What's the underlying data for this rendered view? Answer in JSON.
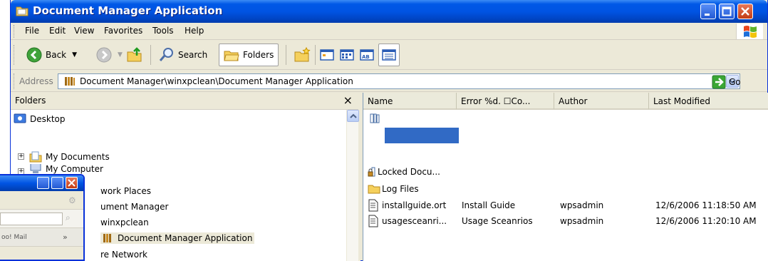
{
  "window": {
    "title": "Document Manager Application",
    "icon": "folder-icon"
  },
  "menu": [
    "File",
    "Edit",
    "View",
    "Favorites",
    "Tools",
    "Help"
  ],
  "toolbar": {
    "back_label": "Back",
    "search_label": "Search",
    "folders_label": "Folders"
  },
  "address": {
    "label": "Address",
    "path": "Document Manager\\winxpclean\\Document Manager Application",
    "go_label": "Go"
  },
  "folders_pane": {
    "title": "Folders",
    "tree": [
      {
        "label": "Desktop",
        "icon": "desktop-icon"
      },
      {
        "label": "My Documents",
        "icon": "my-documents-icon"
      },
      {
        "label": "My Computer",
        "icon": "my-computer-icon"
      },
      {
        "label": "work Places",
        "icon": "network-places-icon"
      },
      {
        "label": "ument Manager",
        "icon": "document-manager-icon"
      },
      {
        "label": "winxpclean",
        "icon": "folder-icon"
      },
      {
        "label": "Document Manager Application",
        "icon": "library-icon"
      },
      {
        "label": "re Network",
        "icon": "network-icon"
      }
    ]
  },
  "files_pane": {
    "columns": [
      "Name",
      "Error %d. ☐Co...",
      "Author",
      "Last Modified"
    ],
    "rows": [
      {
        "name": "",
        "icon": "library-icon",
        "title": "",
        "author": "",
        "modified": ""
      },
      {
        "name": "Locked Docu...",
        "icon": "locked-folder-icon",
        "title": "",
        "author": "",
        "modified": ""
      },
      {
        "name": "Log Files",
        "icon": "folder-icon",
        "title": "",
        "author": "",
        "modified": ""
      },
      {
        "name": "installguide.ort",
        "icon": "document-icon",
        "title": "Install Guide",
        "author": "wpsadmin",
        "modified": "12/6/2006 11:18:50 AM"
      },
      {
        "name": "usagesceanri...",
        "icon": "document-icon",
        "title": "Usage Sceanrios",
        "author": "wpsadmin",
        "modified": "12/6/2006 11:20:10 AM"
      }
    ]
  },
  "mini_window": {
    "text": "oo! Mail",
    "chevron": "»"
  },
  "colors": {
    "titlebar": "#0054e3",
    "selection": "#316ac5",
    "chrome": "#ece9d8"
  }
}
